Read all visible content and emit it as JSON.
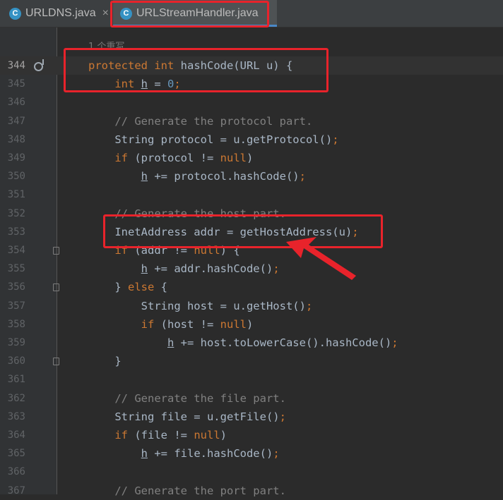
{
  "tabs": [
    {
      "icon": "C",
      "label": "URLDNS.java",
      "close": "×"
    },
    {
      "icon": "C",
      "label": "URLStreamHandler.java",
      "close": "×"
    }
  ],
  "hint": "1 个重写",
  "current_line": 344,
  "lines": [
    {
      "n": "344",
      "parts": [
        [
          "kw",
          "protected int "
        ],
        [
          "",
          "hashCode(URL u) {"
        ]
      ]
    },
    {
      "n": "345",
      "parts": [
        [
          "",
          "    "
        ],
        [
          "kw",
          "int "
        ],
        [
          "fld",
          "h"
        ],
        [
          "",
          " = "
        ],
        [
          "num",
          "0"
        ],
        [
          "kw",
          ";"
        ]
      ]
    },
    {
      "n": "346",
      "parts": []
    },
    {
      "n": "347",
      "parts": [
        [
          "cm",
          "    // Generate the protocol part."
        ]
      ]
    },
    {
      "n": "348",
      "parts": [
        [
          "",
          "    String protocol = u.getProtocol()"
        ],
        [
          "kw",
          ";"
        ]
      ]
    },
    {
      "n": "349",
      "parts": [
        [
          "",
          "    "
        ],
        [
          "kw",
          "if "
        ],
        [
          "",
          "(protocol != "
        ],
        [
          "kw",
          "null"
        ],
        [
          "",
          ")"
        ]
      ]
    },
    {
      "n": "350",
      "parts": [
        [
          "",
          "        "
        ],
        [
          "fld",
          "h"
        ],
        [
          "",
          " += protocol.hashCode()"
        ],
        [
          "kw",
          ";"
        ]
      ]
    },
    {
      "n": "351",
      "parts": []
    },
    {
      "n": "352",
      "parts": [
        [
          "cm",
          "    // Generate the host part."
        ]
      ]
    },
    {
      "n": "353",
      "parts": [
        [
          "",
          "    InetAddress addr = getHostAddress(u)"
        ],
        [
          "kw",
          ";"
        ]
      ]
    },
    {
      "n": "354",
      "parts": [
        [
          "",
          "    "
        ],
        [
          "kw",
          "if "
        ],
        [
          "",
          "(addr != "
        ],
        [
          "kw",
          "null"
        ],
        [
          "",
          ") {"
        ]
      ]
    },
    {
      "n": "355",
      "parts": [
        [
          "",
          "        "
        ],
        [
          "fld",
          "h"
        ],
        [
          "",
          " += addr.hashCode()"
        ],
        [
          "kw",
          ";"
        ]
      ]
    },
    {
      "n": "356",
      "parts": [
        [
          "",
          "    } "
        ],
        [
          "kw",
          "else "
        ],
        [
          "",
          "{"
        ]
      ]
    },
    {
      "n": "357",
      "parts": [
        [
          "",
          "        String host = u.getHost()"
        ],
        [
          "kw",
          ";"
        ]
      ]
    },
    {
      "n": "358",
      "parts": [
        [
          "",
          "        "
        ],
        [
          "kw",
          "if "
        ],
        [
          "",
          "(host != "
        ],
        [
          "kw",
          "null"
        ],
        [
          "",
          ")"
        ]
      ]
    },
    {
      "n": "359",
      "parts": [
        [
          "",
          "            "
        ],
        [
          "fld",
          "h"
        ],
        [
          "",
          " += host.toLowerCase().hashCode()"
        ],
        [
          "kw",
          ";"
        ]
      ]
    },
    {
      "n": "360",
      "parts": [
        [
          "",
          "    }"
        ]
      ]
    },
    {
      "n": "361",
      "parts": []
    },
    {
      "n": "362",
      "parts": [
        [
          "cm",
          "    // Generate the file part."
        ]
      ]
    },
    {
      "n": "363",
      "parts": [
        [
          "",
          "    String file = u.getFile()"
        ],
        [
          "kw",
          ";"
        ]
      ]
    },
    {
      "n": "364",
      "parts": [
        [
          "",
          "    "
        ],
        [
          "kw",
          "if "
        ],
        [
          "",
          "(file != "
        ],
        [
          "kw",
          "null"
        ],
        [
          "",
          ")"
        ]
      ]
    },
    {
      "n": "365",
      "parts": [
        [
          "",
          "        "
        ],
        [
          "fld",
          "h"
        ],
        [
          "",
          " += file.hashCode()"
        ],
        [
          "kw",
          ";"
        ]
      ]
    },
    {
      "n": "366",
      "parts": []
    },
    {
      "n": "367",
      "parts": [
        [
          "cm",
          "    // Generate the port part."
        ]
      ]
    }
  ]
}
